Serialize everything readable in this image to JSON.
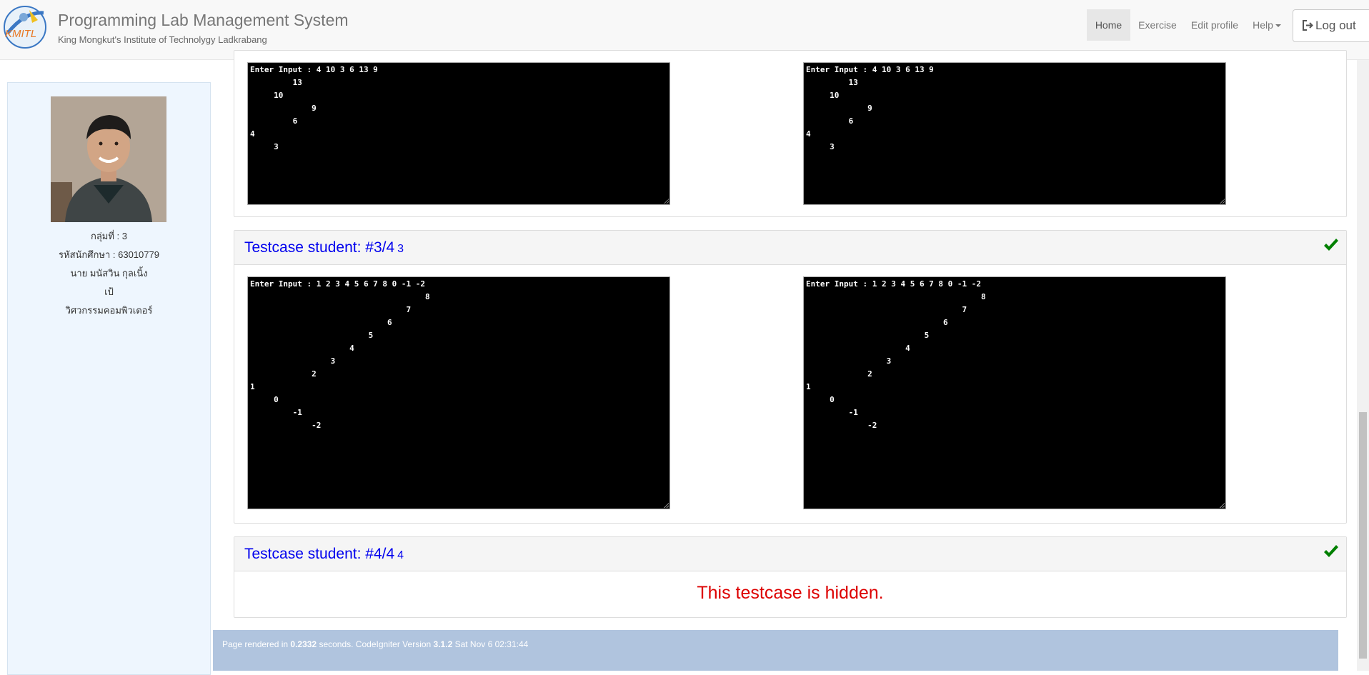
{
  "header": {
    "logo_text": "KMITL",
    "title": "Programming Lab Management System",
    "subtitle": "King Mongkut's Institute of Technolygy Ladkrabang",
    "nav": {
      "home": "Home",
      "exercise": "Exercise",
      "edit_profile": "Edit profile",
      "help": "Help",
      "logout": "Log out"
    }
  },
  "sidebar": {
    "group": "กลุ่มที่ : 3",
    "student_id": "รหัสนักศึกษา : 63010779",
    "name": "นาย มนัสวิน กุลเนิ้ง",
    "nickname": "เป้",
    "department": "วิศวกรรมคอมพิวเตอร์"
  },
  "testcase2": {
    "expected_output": "Enter Input : 4 10 3 6 13 9\n         13\n     10\n             9\n         6\n4\n     3",
    "student_output": "Enter Input : 4 10 3 6 13 9\n         13\n     10\n             9\n         6\n4\n     3"
  },
  "testcase3": {
    "title": "Testcase student: #3/4",
    "number": "3",
    "expected_output": "Enter Input : 1 2 3 4 5 6 7 8 0 -1 -2\n                                     8\n                                 7\n                             6\n                         5\n                     4\n                 3\n             2\n1\n     0\n         -1\n             -2",
    "student_output": "Enter Input : 1 2 3 4 5 6 7 8 0 -1 -2\n                                     8\n                                 7\n                             6\n                         5\n                     4\n                 3\n             2\n1\n     0\n         -1\n             -2",
    "status_icon": "check-icon",
    "status_color": "#008000"
  },
  "testcase4": {
    "title": "Testcase student: #4/4",
    "number": "4",
    "hidden_message": "This testcase is hidden.",
    "status_icon": "check-icon",
    "status_color": "#008000"
  },
  "footer": {
    "prefix": "Page rendered in ",
    "render_time": "0.2332",
    "middle": " seconds. CodeIgniter Version ",
    "version": "3.1.2",
    "date": " Sat Nov 6 02:31:44"
  }
}
